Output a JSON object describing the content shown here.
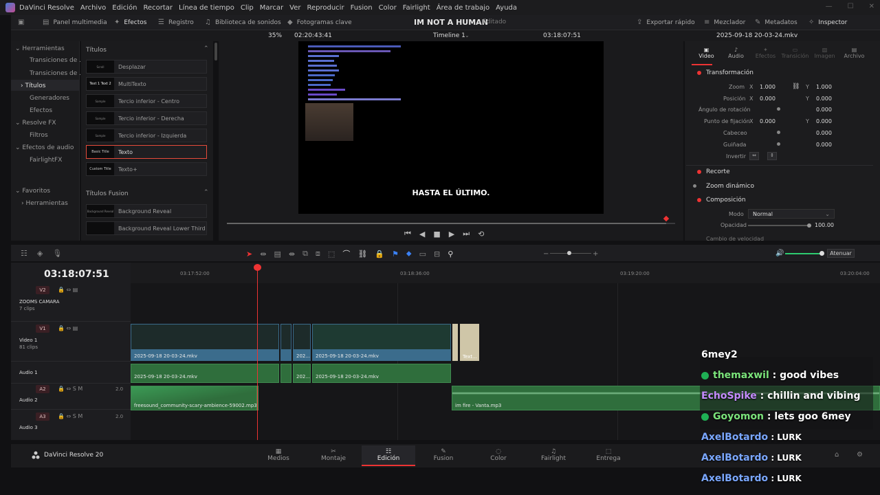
{
  "menubar": {
    "app": "DaVinci Resolve",
    "items": [
      "Archivo",
      "Edición",
      "Recortar",
      "Línea de tiempo",
      "Clip",
      "Marcar",
      "Ver",
      "Reproducir",
      "Fusion",
      "Color",
      "Fairlight",
      "Área de trabajo",
      "Ayuda"
    ]
  },
  "toolbar": {
    "media_pool": "Panel multimedia",
    "effects": "Efectos",
    "index": "Registro",
    "sound_library": "Biblioteca de sonidos",
    "keyframes": "Fotogramas clave",
    "project_title": "IM NOT A HUMAN",
    "project_status": "Editado",
    "quick_export": "Exportar rápido",
    "mixer": "Mezclador",
    "metadata": "Metadatos",
    "inspector": "Inspector"
  },
  "effects": {
    "categories": [
      "Herramientas",
      "Transiciones de ...",
      "Transiciones de ...",
      "Títulos",
      "Generadores",
      "Efectos",
      "Resolve FX",
      "Filtros",
      "Efectos de audio",
      "FairlightFX",
      "Favoritos",
      "Herramientas"
    ],
    "selected_category": "Títulos",
    "titles_header": "Títulos",
    "titles": [
      {
        "label": "Desplazar",
        "thumb": "Scroll"
      },
      {
        "label": "MultiTexto",
        "thumb": "Text 1 Text 2"
      },
      {
        "label": "Tercio inferior - Centro",
        "thumb": "Sample"
      },
      {
        "label": "Tercio inferior - Derecha",
        "thumb": "Sample"
      },
      {
        "label": "Tercio inferior - Izquierda",
        "thumb": "Sample"
      },
      {
        "label": "Texto",
        "thumb": "Basic Title"
      },
      {
        "label": "Texto+",
        "thumb": "Custom Title"
      }
    ],
    "fusion_header": "Títulos Fusion",
    "fusion_titles": [
      {
        "label": "Background Reveal",
        "thumb": "Background Reveal"
      },
      {
        "label": "Background Reveal Lower Third",
        "thumb": ""
      }
    ]
  },
  "viewer": {
    "zoom": "35%",
    "source_timecode": "02:20:43:41",
    "timeline_name": "Timeline 1",
    "record_timecode": "03:18:07:51",
    "subtitle": "HASTA EL ÚLTIMO.",
    "progress": 0.98
  },
  "inspector": {
    "clip_name": "2025-09-18 20-03-24.mkv",
    "tabs": [
      "Video",
      "Audio",
      "Efectos",
      "Transición",
      "Imagen",
      "Archivo"
    ],
    "active_tab": "Video",
    "transform_header": "Transformación",
    "zoom_label": "Zoom",
    "zoom_x": "1.000",
    "zoom_y": "1.000",
    "position_label": "Posición",
    "pos_x": "0.000",
    "pos_y": "0.000",
    "rotation_label": "Ángulo de rotación",
    "rotation": "0.000",
    "anchor_label": "Punto de fijación",
    "anchor_x": "0.000",
    "anchor_y": "0.000",
    "pitch_label": "Cabeceo",
    "pitch": "0.000",
    "yaw_label": "Guiñada",
    "yaw": "0.000",
    "flip_label": "Invertir",
    "crop_header": "Recorte",
    "dynamic_zoom_header": "Zoom dinámico",
    "composite_header": "Composición",
    "mode_label": "Modo",
    "mode_value": "Normal",
    "opacity_label": "Opacidad",
    "opacity": "100.00",
    "speed_header": "Cambio de velocidad"
  },
  "timeline": {
    "timecode": "03:18:07:51",
    "ruler": [
      "03:17:52:00",
      "03:18:36:00",
      "03:19:20:00",
      "03:20:04:00"
    ],
    "volume_label": "Atenuar",
    "tracks": [
      {
        "tag": "V2",
        "name": "ZOOMS CAMARA",
        "count": "7 clips"
      },
      {
        "tag": "V1",
        "name": "Video 1",
        "count": "81 clips"
      },
      {
        "tag": "A1",
        "name": "Audio 1",
        "count": ""
      },
      {
        "tag": "A2",
        "name": "Audio 2",
        "count": "",
        "level": "2.0"
      },
      {
        "tag": "A3",
        "name": "Audio 3",
        "count": "",
        "level": "2.0"
      }
    ],
    "clips": {
      "v1a": "2025-09-18 20-03-24.mkv",
      "v1b": "202...",
      "v1c": "2025-09-18 20-03-24.mkv",
      "v1text": "Text...",
      "a1a": "2025-09-18 20-03-24.mkv",
      "a1b": "202...",
      "a1c": "2025-09-18 20-03-24.mkv",
      "a2a": "freesound_community-scary-ambience-59002.mp3",
      "a2b": "im fire - Vanta.mp3"
    }
  },
  "pages": {
    "app_name": "DaVinci Resolve 20",
    "items": [
      "Medios",
      "Montaje",
      "Edición",
      "Fusion",
      "Color",
      "Fairlight",
      "Entrega"
    ],
    "active": "Edición"
  },
  "chat": [
    {
      "user": "6mey2",
      "msg": "",
      "color": "#ffffff"
    },
    {
      "user": "themaxwil",
      "msg": " : good vibes",
      "color": "#7be37b",
      "badge": true
    },
    {
      "user": "EchoSpike",
      "msg": " : chillin and vibing",
      "color": "#c58cff",
      "badge": false
    },
    {
      "user": "Goyomon",
      "msg": " : lets goo 6mey",
      "color": "#7be37b",
      "badge": true
    },
    {
      "user": "AxelBotardo",
      "msg": " : LURK",
      "color": "#7aa7ff",
      "badge": false
    },
    {
      "user": "AxelBotardo",
      "msg": " : LURK",
      "color": "#7aa7ff",
      "badge": false
    },
    {
      "user": "AxelBotardo",
      "msg": " : LURK",
      "color": "#7aa7ff",
      "badge": false
    }
  ]
}
